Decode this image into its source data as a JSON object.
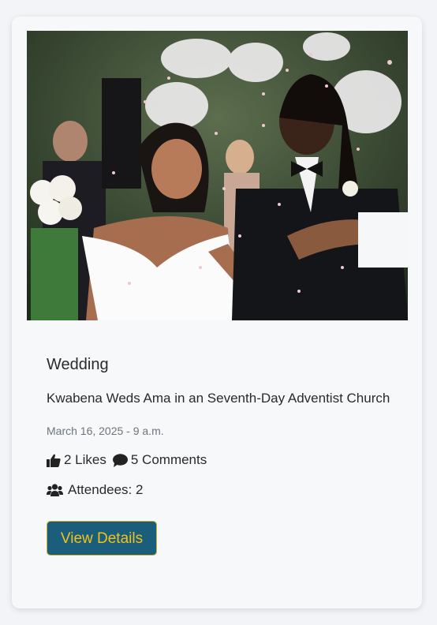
{
  "event": {
    "category": "Wedding",
    "title": "Kwabena Weds Ama in an Seventh-Day Adventist Church",
    "date": "March 16, 2025 - 9 a.m.",
    "likes": "2 Likes",
    "comments": "5 Comments",
    "attendees": "Attendees: 2",
    "button_label": "View Details"
  },
  "icons": {
    "like": "thumbs-up-icon",
    "comment": "comment-bubble-icon",
    "attendees": "users-icon"
  },
  "colors": {
    "button_bg": "#1b5e7c",
    "button_text": "#f1c21b"
  }
}
